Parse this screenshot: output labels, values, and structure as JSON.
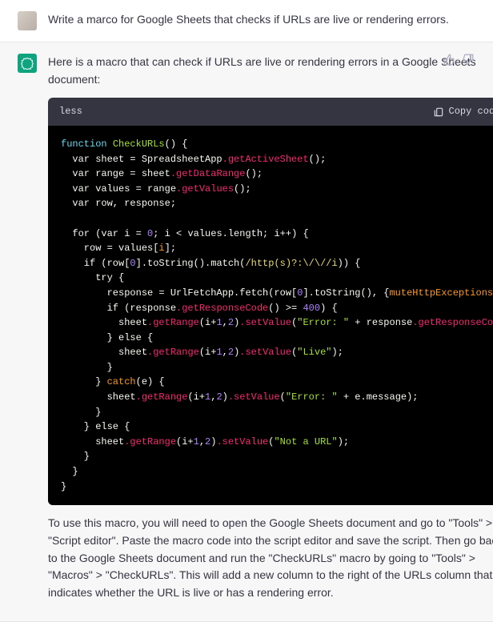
{
  "user": {
    "prompt": "Write a marco for Google Sheets that checks if URLs are live or rendering errors."
  },
  "assistant": {
    "intro": "Here is a macro that can check if URLs are live or rendering errors in a Google Sheets document:",
    "outro": "To use this macro, you will need to open the Google Sheets document and go to \"Tools\" > \"Script editor\". Paste the macro code into the script editor and save the script. Then go back to the Google Sheets document and run the \"CheckURLs\" macro by going to \"Tools\" > \"Macros\" > \"CheckURLs\". This will add a new column to the right of the URLs column that indicates whether the URL is live or has a rendering error."
  },
  "code": {
    "lang": "less",
    "copy_label": "Copy code",
    "lines": {
      "l1a": "function ",
      "l1b": "CheckURLs",
      "l1c": "() {",
      "l2a": "  var sheet = SpreadsheetApp",
      "l2b": ".getActiveSheet",
      "l2c": "();",
      "l3a": "  var range = sheet",
      "l3b": ".getDataRange",
      "l3c": "();",
      "l4a": "  var values = range",
      "l4b": ".getValues",
      "l4c": "();",
      "l5": "  var row, response;",
      "l7a": "  for (var i = ",
      "l7b": "0",
      "l7c": "; i < values.length; i++) {",
      "l8a": "    row = values[",
      "l8b": "i",
      "l8c": "];",
      "l9a": "    if (row[",
      "l9b": "0",
      "l9c": "].toString().match(",
      "l9d": "/http(s)?:\\/\\//i",
      "l9e": ")) {",
      "l10": "      try {",
      "l11a": "        response = UrlFetchApp.fetch(row[",
      "l11b": "0",
      "l11c": "].toString(), {",
      "l11d": "muteHttpExceptions:",
      "l12a": "        if (response",
      "l12b": ".getResponseCode",
      "l12c": "() >= ",
      "l12d": "400",
      "l12e": ") {",
      "l13a": "          sheet",
      "l13b": ".getRange",
      "l13c": "(i+",
      "l13d": "1",
      "l13e": ",",
      "l13f": "2",
      "l13g": ")",
      "l13h": ".setValue",
      "l13i": "(",
      "l13j": "\"Error: \"",
      "l13k": " + response",
      "l13l": ".getResponseCod",
      "l14": "        } else {",
      "l15a": "          sheet",
      "l15b": ".getRange",
      "l15c": "(i+",
      "l15d": "1",
      "l15e": ",",
      "l15f": "2",
      "l15g": ")",
      "l15h": ".setValue",
      "l15i": "(",
      "l15j": "\"Live\"",
      "l15k": ");",
      "l16": "        }",
      "l17a": "      } ",
      "l17b": "catch",
      "l17c": "(e) {",
      "l18a": "        sheet",
      "l18b": ".getRange",
      "l18c": "(i+",
      "l18d": "1",
      "l18e": ",",
      "l18f": "2",
      "l18g": ")",
      "l18h": ".setValue",
      "l18i": "(",
      "l18j": "\"Error: \"",
      "l18k": " + e.message);",
      "l19": "      }",
      "l20": "    } else {",
      "l21a": "      sheet",
      "l21b": ".getRange",
      "l21c": "(i+",
      "l21d": "1",
      "l21e": ",",
      "l21f": "2",
      "l21g": ")",
      "l21h": ".setValue",
      "l21i": "(",
      "l21j": "\"Not a URL\"",
      "l21k": ");",
      "l22": "    }",
      "l23": "  }",
      "l24": "}"
    }
  }
}
